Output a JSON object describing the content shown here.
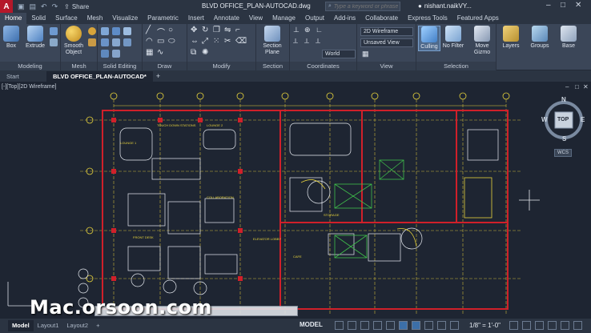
{
  "titlebar": {
    "logo": "A",
    "share_label": "Share",
    "document_title": "BLVD OFFICE_PLAN-AUTOCAD.dwg",
    "search_placeholder": "Type a keyword or phrase",
    "user_name": "nishant.naikVY..."
  },
  "ribbon_tabs": [
    "Home",
    "Solid",
    "Surface",
    "Mesh",
    "Visualize",
    "Parametric",
    "Insert",
    "Annotate",
    "View",
    "Manage",
    "Output",
    "Add-ins",
    "Collaborate",
    "Express Tools",
    "Featured Apps"
  ],
  "ribbon": {
    "groups": [
      "Modeling",
      "Mesh",
      "Solid Editing",
      "Draw",
      "Modify",
      "Section",
      "Coordinates",
      "View",
      "Selection"
    ],
    "tools": {
      "box": "Box",
      "extrude": "Extrude",
      "smooth_object": "Smooth Object",
      "section_plane": "Section Plane",
      "culling": "Culling",
      "no_filter": "No Filter",
      "move_gizmo": "Move Gizmo",
      "layers": "Layers",
      "groups": "Groups",
      "base": "Base"
    },
    "combos": {
      "visual_style": "2D Wireframe",
      "view": "Unsaved View",
      "ucs": "World"
    }
  },
  "doc_tabs": {
    "start": "Start",
    "active": "BLVD OFFICE_PLAN-AUTOCAD*",
    "plus": "+"
  },
  "viewport": {
    "label": "[-][Top][2D Wireframe]",
    "viewcube": {
      "top": "TOP",
      "n": "N",
      "s": "S",
      "e": "E",
      "w": "W",
      "wcs": "WCS"
    },
    "rooms": [
      "LOUNGE 1",
      "TOUCH DOWN STATIONS",
      "LOUNGE 2",
      "COLLABORATION",
      "FRONT DESK",
      "ELEVATOR LOBBY",
      "STORAGE",
      "CAFE"
    ]
  },
  "watermark": "Mac.orsoon.com",
  "statusbar": {
    "layouts": [
      "Model",
      "Layout1",
      "Layout2"
    ],
    "model_label": "MODEL",
    "scale": "1/8\" = 1'-0\""
  },
  "colors": {
    "background": "#1e2532",
    "wall_red": "#d0202a",
    "grid_yellow": "#e6d23c",
    "furniture_white": "#e8ecf2",
    "ribbon": "#3b4658"
  }
}
